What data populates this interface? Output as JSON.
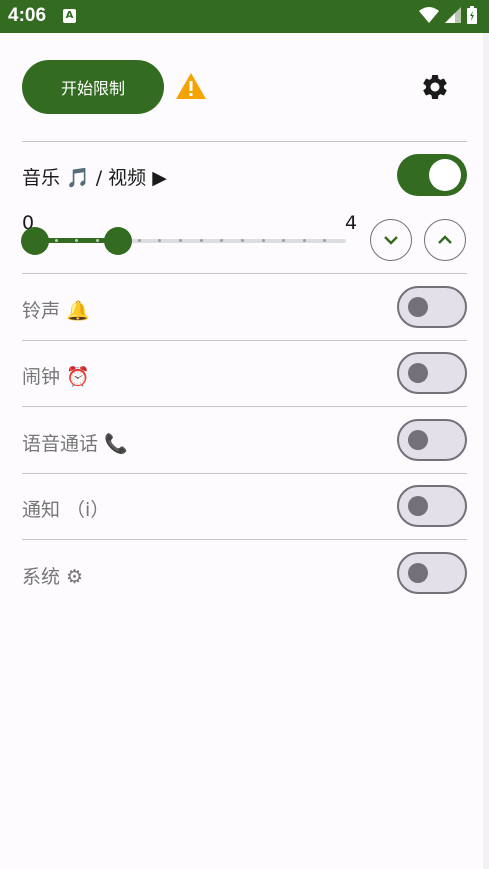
{
  "status_bar": {
    "time": "4:06",
    "notif_glyph": "A"
  },
  "header": {
    "start_label": "开始限制"
  },
  "slider": {
    "min_label": "0",
    "max_label": "4",
    "value": 1,
    "max": 4
  },
  "rows": [
    {
      "label": "音乐 🎵 / 视频 ▶",
      "enabled": true
    },
    {
      "label": "铃声 🔔",
      "enabled": false
    },
    {
      "label": "闹钟 ⏰",
      "enabled": false
    },
    {
      "label": "语音通话 📞",
      "enabled": false
    },
    {
      "label": "通知 （i）",
      "enabled": false
    },
    {
      "label": "系统 ⚙",
      "enabled": false
    }
  ],
  "colors": {
    "accent": "#336b21",
    "warning": "#f5a300",
    "off_track": "#e3e0ea"
  }
}
